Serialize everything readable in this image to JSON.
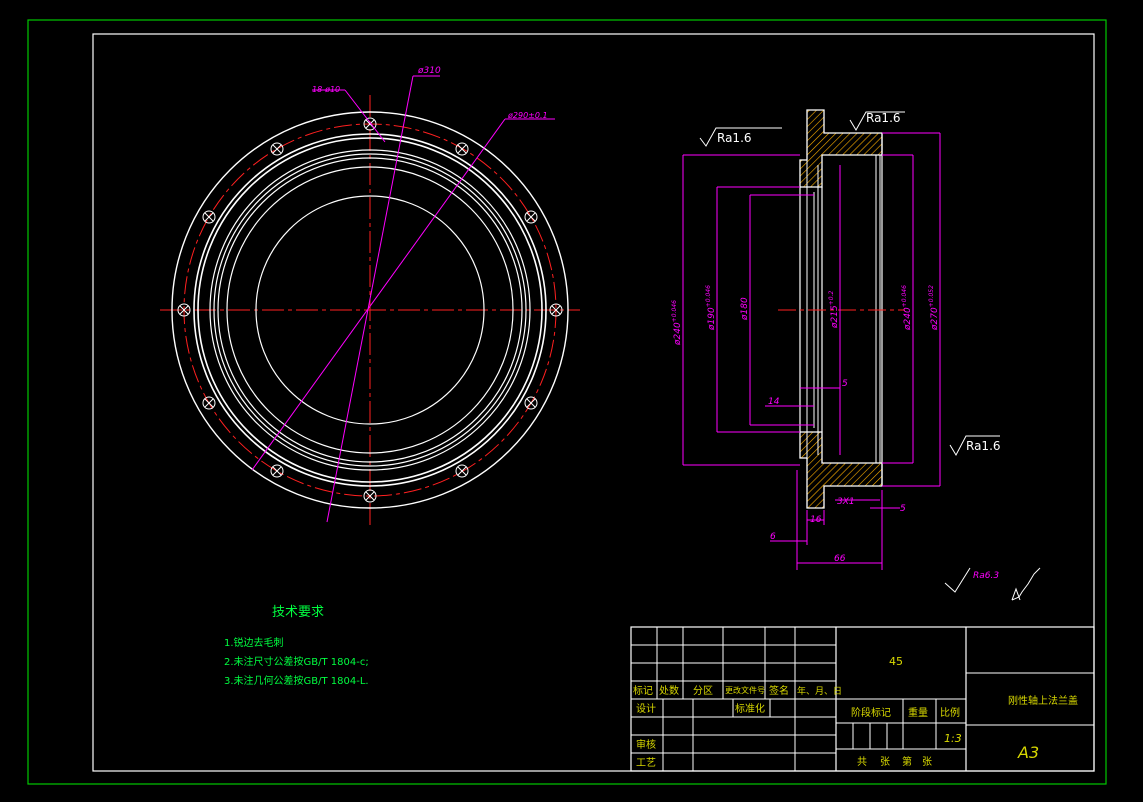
{
  "colors": {
    "background": "#000000",
    "outer_border": "#00c800",
    "frame": "#ffffff",
    "center_line": "#ff2020",
    "dimension": "#ff00ff",
    "note_text": "#00ff40",
    "title_text": "#d8d800",
    "hatch": "#ffb000"
  },
  "front_view": {
    "dim_diameter_outer": "ø310",
    "dim_holes": "18-ø10",
    "dim_bolt_circle": "ø290±0.1"
  },
  "section_view": {
    "roughness_top_left": "Ra1.6",
    "roughness_top_right": "Ra1.6",
    "roughness_right": "Ra1.6",
    "dim_d240_left": "ø240",
    "dim_d240_left_tol": "+0.046",
    "dim_d190": "ø190",
    "dim_d190_tol": "+0.046",
    "dim_d180": "ø180",
    "dim_d215": "ø215",
    "dim_d215_tol": "+0.2",
    "dim_d240_right": "ø240",
    "dim_d240_right_tol": "+0.046",
    "dim_d270": "ø270",
    "dim_d270_tol": "+0.052",
    "dim_5_upper": "5",
    "dim_14": "14",
    "dim_3x1": "3X1",
    "dim_5_lower": "5",
    "dim_16": "16",
    "dim_6": "6",
    "dim_66": "66",
    "general_roughness": "Ra6.3"
  },
  "tech_requirements": {
    "title": "技术要求",
    "items": [
      "1.锐边去毛刺",
      "2.未注尺寸公差按GB/T 1804-c;",
      "3.未注几何公差按GB/T 1804-L."
    ]
  },
  "title_block": {
    "material": "45",
    "part_name": "刚性轴上法兰盖",
    "sheet_size": "A3",
    "scale": "1:3",
    "col_mark": "标记",
    "col_count": "处数",
    "col_zone": "分区",
    "col_change_doc": "更改文件号",
    "col_signature": "签名",
    "col_date": "年、月、日",
    "row_design": "设计",
    "row_standardize": "标准化",
    "row_review": "审核",
    "row_process": "工艺",
    "stage_mark": "阶段标记",
    "weight": "重量",
    "ratio": "比例",
    "sheets_total": "共",
    "sheets_unit1": "张",
    "sheets_nth": "第",
    "sheets_unit2": "张"
  }
}
